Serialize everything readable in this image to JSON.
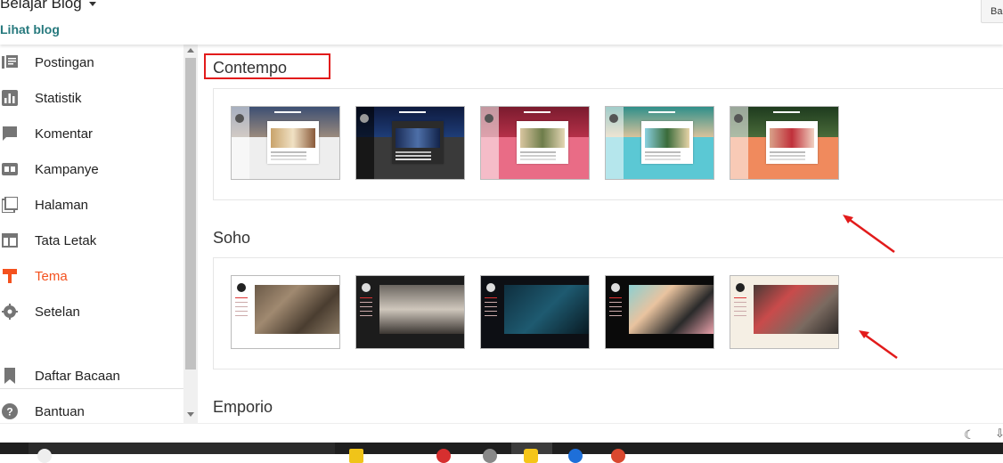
{
  "header": {
    "blog_title": "Belajar Blog",
    "view_blog": "Lihat blog",
    "top_button": "Ba"
  },
  "sidebar": {
    "items": [
      {
        "label": "Postingan",
        "icon": "posts-icon"
      },
      {
        "label": "Statistik",
        "icon": "stats-icon"
      },
      {
        "label": "Komentar",
        "icon": "comment-icon"
      },
      {
        "label": "Kampanye",
        "icon": "ad-icon"
      },
      {
        "label": "Halaman",
        "icon": "pages-icon"
      },
      {
        "label": "Tata Letak",
        "icon": "layout-icon"
      },
      {
        "label": "Tema",
        "icon": "theme-icon",
        "active": true
      },
      {
        "label": "Setelan",
        "icon": "gear-icon"
      }
    ],
    "secondary": [
      {
        "label": "Daftar Bacaan",
        "icon": "bookmark-icon"
      },
      {
        "label": "Bantuan",
        "icon": "help-icon"
      }
    ]
  },
  "themes": {
    "sections": [
      {
        "title": "Contempo"
      },
      {
        "title": "Soho"
      },
      {
        "title": "Emporio"
      }
    ]
  },
  "colors": {
    "accent": "#f4511e",
    "link": "#26797d",
    "highlight": "#e21b1b"
  }
}
